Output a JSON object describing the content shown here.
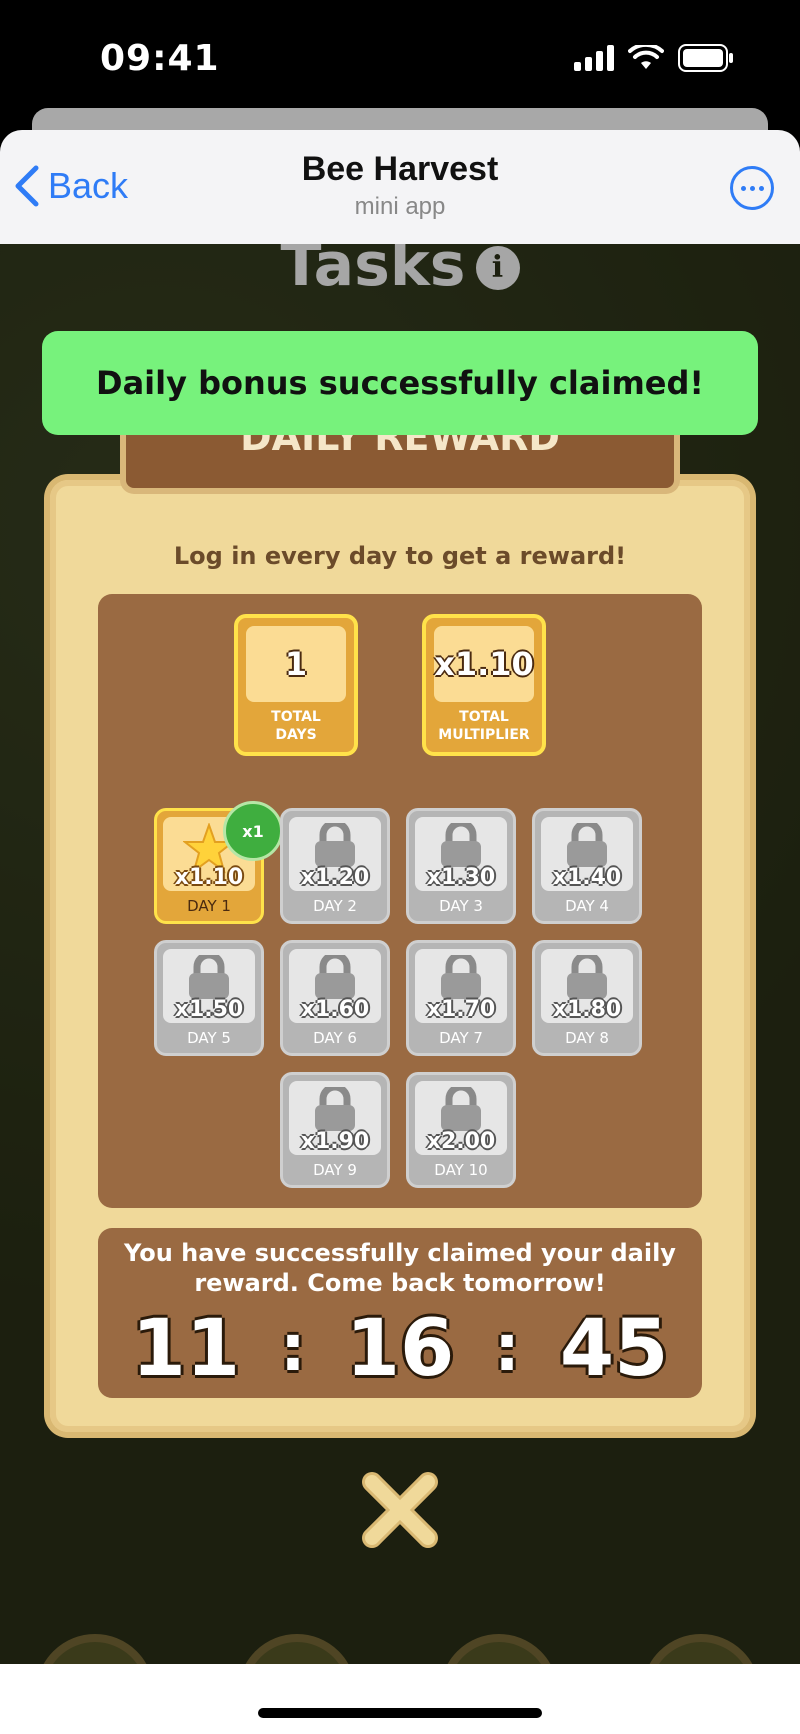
{
  "status_bar": {
    "time": "09:41"
  },
  "header": {
    "back_label": "Back",
    "title": "Bee Harvest",
    "subtitle": "mini app"
  },
  "page": {
    "heading": "Tasks",
    "info_symbol": "i"
  },
  "toast": {
    "message": "Daily bonus successfully claimed!"
  },
  "daily_reward": {
    "banner_title": "DAILY REWARD",
    "subtitle": "Log in every day to get a reward!",
    "stats": [
      {
        "value": "1",
        "label_line1": "TOTAL",
        "label_line2": "DAYS"
      },
      {
        "value": "x1.10",
        "label_line1": "TOTAL",
        "label_line2": "MULTIPLIER"
      }
    ],
    "days": [
      {
        "label": "DAY 1",
        "multiplier": "x1.10",
        "state": "claimed",
        "badge": "x1"
      },
      {
        "label": "DAY 2",
        "multiplier": "x1.20",
        "state": "locked"
      },
      {
        "label": "DAY 3",
        "multiplier": "x1.30",
        "state": "locked"
      },
      {
        "label": "DAY 4",
        "multiplier": "x1.40",
        "state": "locked"
      },
      {
        "label": "DAY 5",
        "multiplier": "x1.50",
        "state": "locked"
      },
      {
        "label": "DAY 6",
        "multiplier": "x1.60",
        "state": "locked"
      },
      {
        "label": "DAY 7",
        "multiplier": "x1.70",
        "state": "locked"
      },
      {
        "label": "DAY 8",
        "multiplier": "x1.80",
        "state": "locked"
      },
      {
        "label": "DAY 9",
        "multiplier": "x1.90",
        "state": "locked"
      },
      {
        "label": "DAY 10",
        "multiplier": "x2.00",
        "state": "locked"
      }
    ],
    "claimed_message": "You have successfully claimed your daily reward. Come back tomorrow!",
    "timer": {
      "hours": "11",
      "minutes": "16",
      "seconds": "45",
      "separator": ":"
    }
  },
  "colors": {
    "toast_bg": "#77f27c",
    "link_blue": "#2f7cf6",
    "board_brown": "#9a6a42",
    "parchment": "#f0d99a",
    "gold": "#e3a63a"
  }
}
